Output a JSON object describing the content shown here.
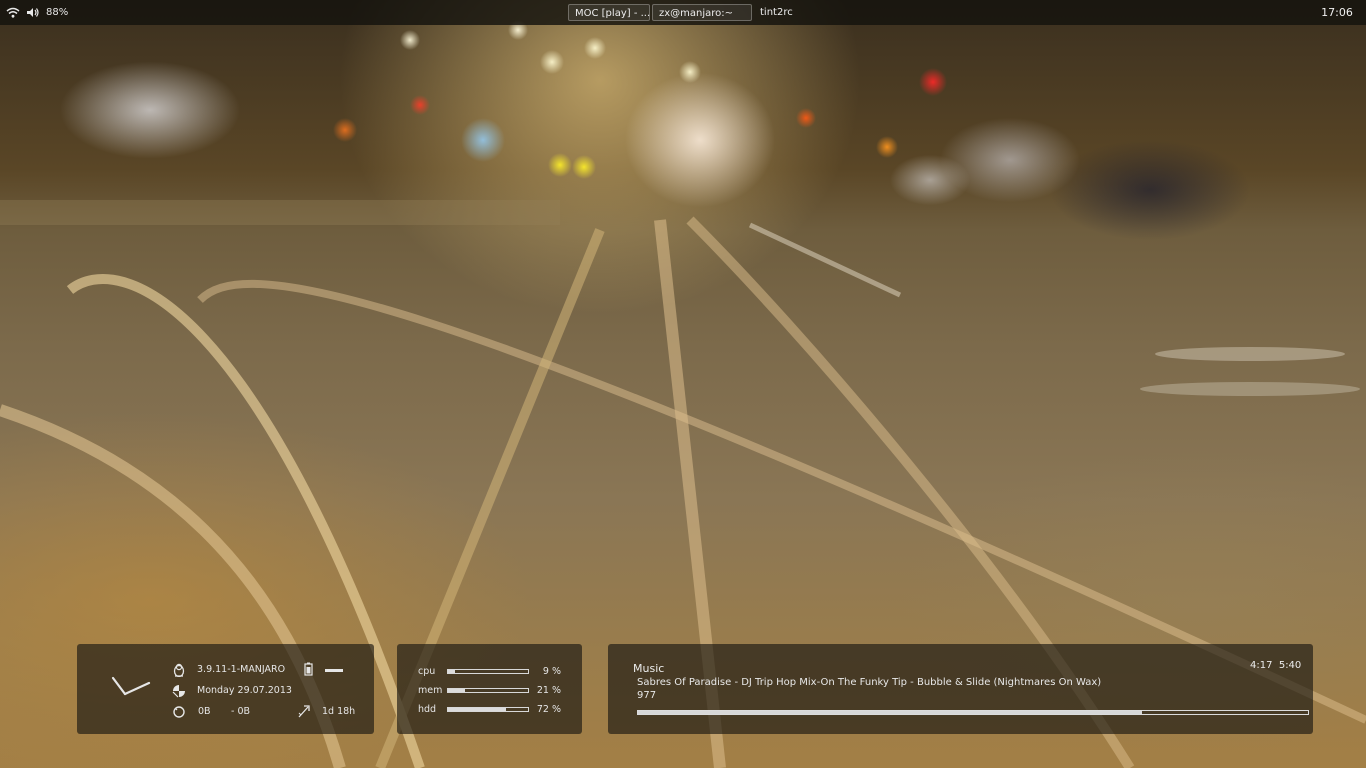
{
  "top_panel": {
    "battery_percent": "88%",
    "tasks": [
      {
        "label": "MOC [play] - ...",
        "active": true
      },
      {
        "label": "zx@manjaro:~",
        "active": true
      },
      {
        "label": "tint2rc",
        "active": false
      }
    ],
    "clock": "17:06",
    "icons": [
      "wifi-icon",
      "volume-icon"
    ]
  },
  "system_widget": {
    "kernel": "3.9.11-1-MANJARO",
    "date": "Monday 29.07.2013",
    "net_down": "0B",
    "net_up": "- 0B",
    "uptime": "1d 18h",
    "icons": [
      "analog-clock-icon",
      "tux-icon",
      "calendar-icon",
      "network-icon",
      "battery-icon",
      "uptime-icon"
    ]
  },
  "resources_widget": {
    "meters": [
      {
        "label": "cpu",
        "value": "9 %",
        "fraction": 0.09
      },
      {
        "label": "mem",
        "value": "21 %",
        "fraction": 0.21
      },
      {
        "label": "hdd",
        "value": "72 %",
        "fraction": 0.72
      }
    ]
  },
  "music_widget": {
    "label": "Music",
    "track": "Sabres Of Paradise - DJ Trip Hop Mix-On The Funky Tip - Bubble & Slide (Nightmares On Wax)",
    "sub": "977",
    "elapsed": "4:17",
    "total": "5:40",
    "progress_fraction": 0.752
  }
}
